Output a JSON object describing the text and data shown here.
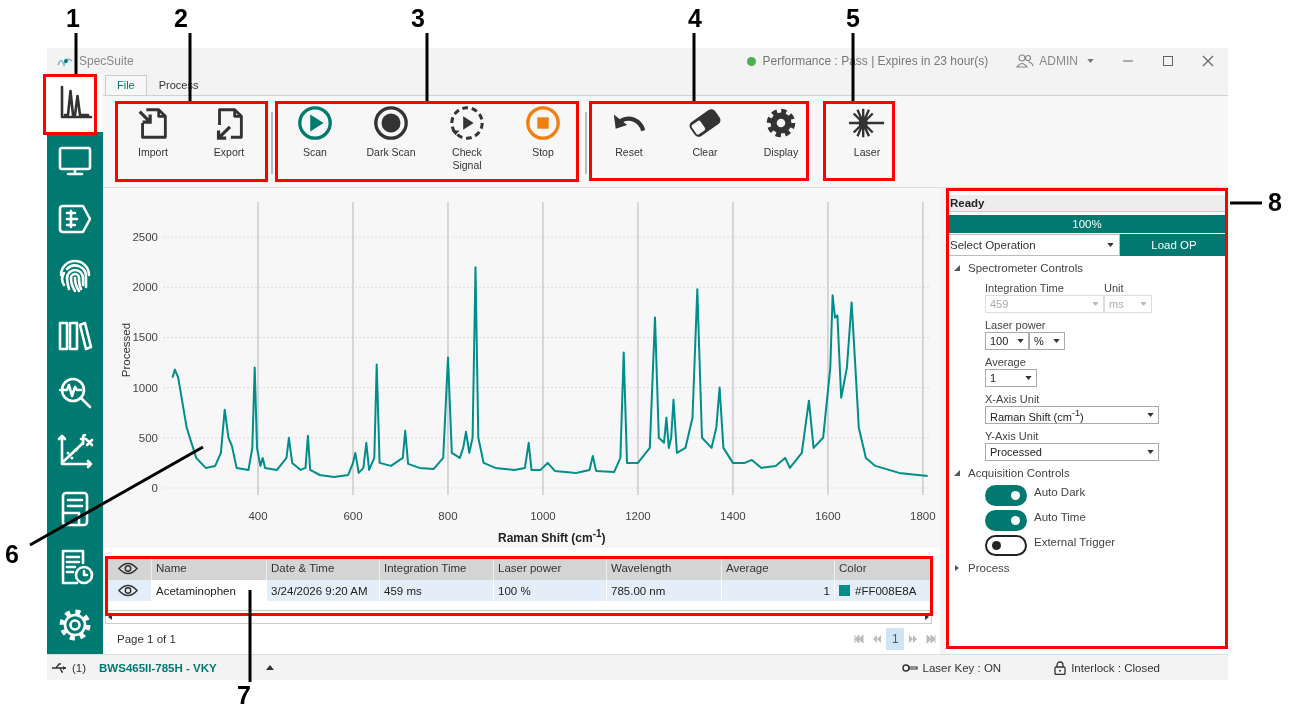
{
  "callouts": [
    {
      "label": "1"
    },
    {
      "label": "2"
    },
    {
      "label": "3"
    },
    {
      "label": "4"
    },
    {
      "label": "5"
    },
    {
      "label": "6"
    },
    {
      "label": "7"
    },
    {
      "label": "8"
    }
  ],
  "window": {
    "title": "SpecSuite",
    "status": {
      "text": "Performance : Pass | Expires in 23 hour(s)",
      "color": "#4caf50"
    },
    "user": "ADMIN"
  },
  "sidebar": {
    "items": [
      {
        "kind": "spectrum",
        "selected": true
      },
      {
        "kind": "monitor",
        "selected": false
      },
      {
        "kind": "tag",
        "selected": false
      },
      {
        "kind": "fingerprint",
        "selected": false
      },
      {
        "kind": "library",
        "selected": false
      },
      {
        "kind": "analysis",
        "selected": false
      },
      {
        "kind": "function",
        "selected": false
      },
      {
        "kind": "report",
        "selected": false
      },
      {
        "kind": "report-clock",
        "selected": false
      },
      {
        "kind": "settings",
        "selected": false
      }
    ]
  },
  "tabs": [
    {
      "label": "File",
      "selected": true
    },
    {
      "label": "Process",
      "selected": false
    }
  ],
  "ribbon": {
    "groups": [
      {
        "buttons": [
          {
            "kind": "import",
            "label": "Import"
          },
          {
            "kind": "export",
            "label": "Export"
          }
        ]
      },
      {
        "buttons": [
          {
            "kind": "scan",
            "label": "Scan"
          },
          {
            "kind": "dark-scan",
            "label": "Dark Scan"
          },
          {
            "kind": "check",
            "label": "Check Signal"
          },
          {
            "kind": "stop",
            "label": "Stop"
          }
        ]
      },
      {
        "buttons": [
          {
            "kind": "reset",
            "label": "Reset"
          },
          {
            "kind": "clear",
            "label": "Clear"
          },
          {
            "kind": "display",
            "label": "Display"
          }
        ]
      },
      {
        "buttons": [
          {
            "kind": "laser",
            "label": "Laser"
          }
        ]
      }
    ]
  },
  "chart": {
    "chart_data": {
      "type": "line",
      "grid": true,
      "xlabel": "Raman Shift (cm$^{-1}$)",
      "ylabel": "Processed",
      "xlim": [
        200,
        1815
      ],
      "ylim": [
        0,
        2850
      ],
      "xticks": [
        400,
        600,
        800,
        1000,
        1200,
        1400,
        1600,
        1800
      ],
      "yticks": [
        0,
        500,
        1000,
        1500,
        2000,
        2500
      ],
      "x": [
        220,
        225,
        232,
        250,
        270,
        290,
        310,
        322,
        330,
        338,
        345,
        355,
        380,
        388,
        393,
        398,
        405,
        410,
        415,
        440,
        460,
        465,
        472,
        490,
        500,
        505,
        510,
        530,
        560,
        590,
        600,
        605,
        612,
        622,
        628,
        634,
        645,
        650,
        656,
        680,
        705,
        710,
        716,
        740,
        770,
        790,
        800,
        808,
        825,
        832,
        838,
        845,
        852,
        858,
        864,
        875,
        900,
        940,
        962,
        970,
        976,
        995,
        1010,
        1025,
        1070,
        1098,
        1105,
        1112,
        1150,
        1163,
        1170,
        1177,
        1200,
        1225,
        1236,
        1244,
        1255,
        1260,
        1265,
        1270,
        1275,
        1282,
        1300,
        1315,
        1325,
        1335,
        1355,
        1365,
        1372,
        1380,
        1400,
        1425,
        1440,
        1460,
        1490,
        1510,
        1520,
        1545,
        1560,
        1570,
        1590,
        1605,
        1610,
        1615,
        1620,
        1628,
        1640,
        1650,
        1658,
        1665,
        1680,
        1700,
        1750,
        1810
      ],
      "series": [
        {
          "color": "#008e8a",
          "values": [
            1100,
            1180,
            1100,
            600,
            300,
            200,
            220,
            350,
            780,
            500,
            420,
            200,
            180,
            400,
            1200,
            400,
            220,
            300,
            200,
            180,
            300,
            500,
            250,
            180,
            200,
            520,
            180,
            130,
            110,
            130,
            250,
            350,
            150,
            200,
            450,
            180,
            300,
            1230,
            250,
            220,
            300,
            570,
            240,
            200,
            190,
            300,
            1300,
            350,
            300,
            400,
            560,
            350,
            500,
            2200,
            500,
            250,
            200,
            180,
            200,
            450,
            180,
            180,
            250,
            170,
            150,
            180,
            320,
            170,
            160,
            300,
            1350,
            250,
            250,
            400,
            1700,
            500,
            450,
            700,
            400,
            500,
            880,
            350,
            400,
            700,
            1980,
            500,
            400,
            600,
            1000,
            400,
            250,
            250,
            280,
            200,
            220,
            300,
            200,
            350,
            870,
            400,
            500,
            1200,
            1920,
            1700,
            1720,
            900,
            1200,
            1850,
            1200,
            600,
            300,
            220,
            150,
            120
          ]
        }
      ]
    }
  },
  "table": {
    "columns": [
      "Name",
      "Date & Time",
      "Integration Time",
      "Laser power",
      "Wavelength",
      "Average",
      "Color"
    ],
    "rows": [
      {
        "visible": true,
        "cells": [
          "Acetaminophen",
          "3/24/2026 9:20 AM",
          "459 ms",
          "100 %",
          "785.00 nm",
          "1"
        ],
        "color": "#008e8a",
        "color_text": "#FF008E8A"
      }
    ],
    "pager": {
      "text": "Page 1 of 1",
      "pages": [
        {
          "label": "1",
          "selected": true
        }
      ]
    }
  },
  "panel": {
    "status": "Ready",
    "progress": {
      "level": 1,
      "text": "100%"
    },
    "operation": {
      "placeholder": "Select Operation"
    },
    "load_button": "Load OP",
    "sections": [
      {
        "title": "Spectrometer Controls",
        "expanded": true,
        "fields": [
          {
            "labels": [
              "Integration Time",
              "Unit"
            ],
            "selects": [
              {
                "value": "459",
                "disabled": true
              },
              {
                "value": "ms",
                "disabled": true
              }
            ]
          },
          {
            "labels": [
              "Laser power"
            ],
            "selects": [
              {
                "value": "100",
                "disabled": false
              },
              {
                "value": "%",
                "disabled": false
              }
            ]
          },
          {
            "labels": [
              "Average"
            ],
            "selects": [
              {
                "value": "1",
                "disabled": false
              }
            ]
          },
          {
            "labels": [
              "X-Axis Unit"
            ],
            "selects": [
              {
                "value": "Raman Shift (cm$^{-1}$)",
                "disabled": false
              }
            ]
          },
          {
            "labels": [
              "Y-Axis Unit"
            ],
            "selects": [
              {
                "value": "Processed",
                "disabled": false
              }
            ]
          }
        ]
      },
      {
        "title": "Acquisition Controls",
        "expanded": true,
        "toggles": [
          {
            "label": "Auto Dark",
            "on": true
          },
          {
            "label": "Auto Time",
            "on": true
          },
          {
            "label": "External Trigger",
            "on": false
          }
        ]
      },
      {
        "title": "Process",
        "expanded": false
      }
    ]
  },
  "status_bar": {
    "device_count": "(1)",
    "device": "BWS465II-785H - VKY",
    "laser_key": "Laser Key : ON",
    "interlock": "Interlock : Closed"
  }
}
